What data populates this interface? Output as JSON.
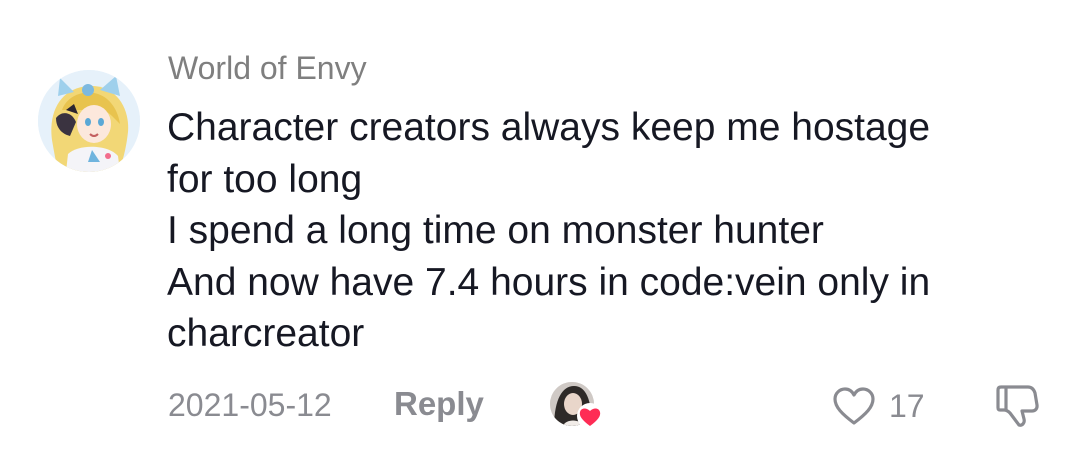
{
  "comment": {
    "username": "World of Envy",
    "text": "Character creators always keep me hostage\nfor too long\nI spend a long time on monster hunter\nAnd now have 7.4 hours in code:vein only in\ncharcreator",
    "date": "2021-05-12",
    "reply_label": "Reply",
    "like_count": "17",
    "liked_by_creator": true
  },
  "colors": {
    "text": "#161823",
    "secondary_text": "#8a8b91",
    "username": "#7f7f7f",
    "heart_badge": "#fe2c55"
  },
  "icons": {
    "like": "heart-outline-icon",
    "dislike": "thumbs-down-icon",
    "creator_like_badge": "heart-badge-icon"
  }
}
